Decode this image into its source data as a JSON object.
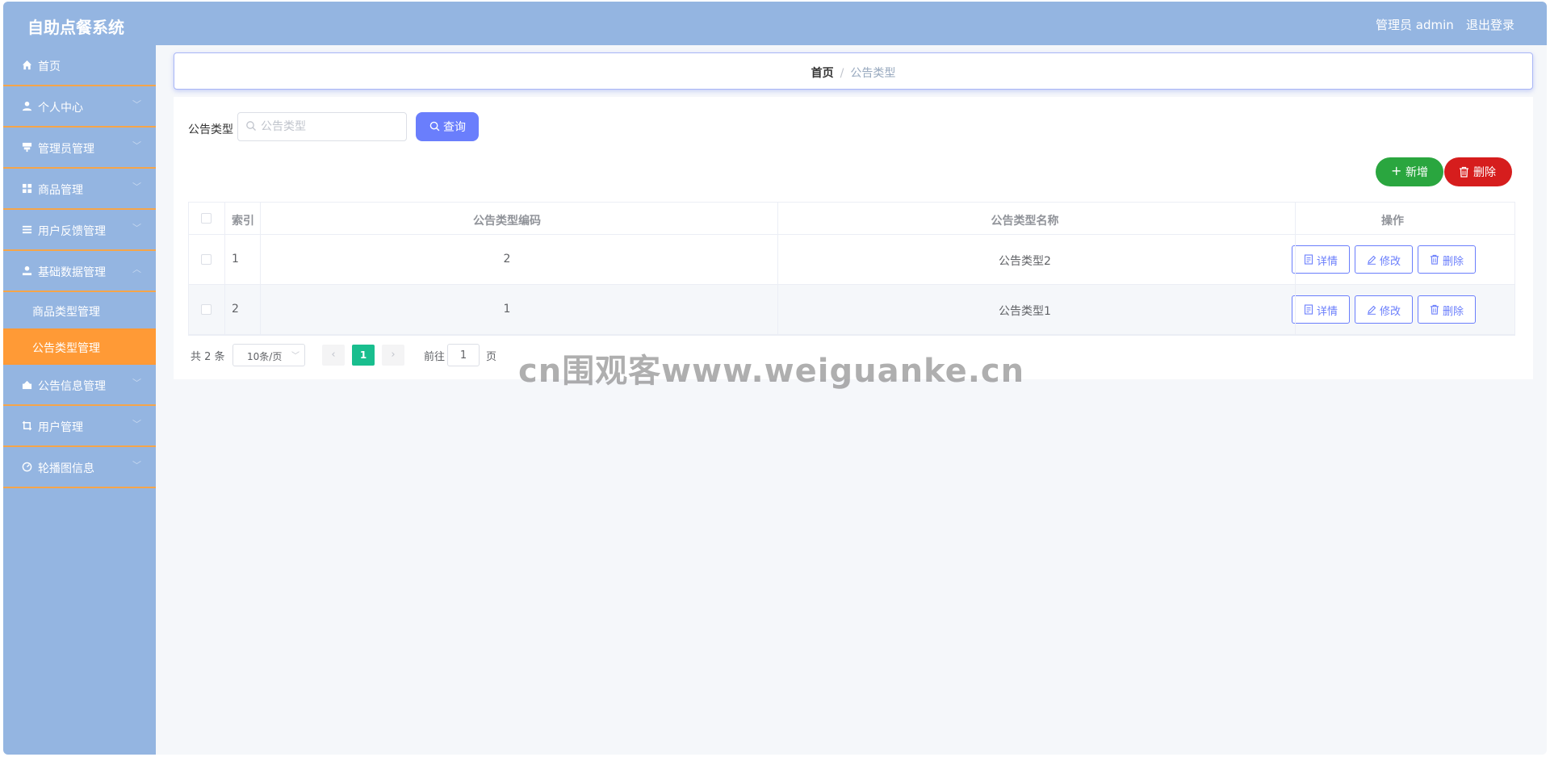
{
  "app": {
    "title": "自助点餐系统"
  },
  "header": {
    "user_text": "管理员 admin",
    "logout_label": "退出登录"
  },
  "sidebar": {
    "items": [
      {
        "label": "首页",
        "icon": "home-icon"
      },
      {
        "label": "个人中心",
        "icon": "user-icon"
      },
      {
        "label": "管理员管理",
        "icon": "admin-icon"
      },
      {
        "label": "商品管理",
        "icon": "grid-icon"
      },
      {
        "label": "用户反馈管理",
        "icon": "list-icon"
      },
      {
        "label": "基础数据管理",
        "icon": "person-icon"
      },
      {
        "label": "公告信息管理",
        "icon": "announce-icon"
      },
      {
        "label": "用户管理",
        "icon": "crop-icon"
      },
      {
        "label": "轮播图信息",
        "icon": "dashboard-icon"
      }
    ],
    "subitems": [
      {
        "label": "商品类型管理",
        "active": false
      },
      {
        "label": "公告类型管理",
        "active": true
      }
    ],
    "active_color": "#ff9a36"
  },
  "breadcrumb": {
    "home": "首页",
    "separator": "/",
    "current": "公告类型"
  },
  "filter": {
    "label": "公告类型",
    "placeholder": "公告类型",
    "value": "",
    "query_label": "查询"
  },
  "actions": {
    "add_label": "新增",
    "delete_label": "删除"
  },
  "table": {
    "headers": [
      "索引",
      "公告类型编码",
      "公告类型名称",
      "操作"
    ],
    "rows": [
      {
        "index": "1",
        "code": "2",
        "name": "公告类型2"
      },
      {
        "index": "2",
        "code": "1",
        "name": "公告类型1"
      }
    ],
    "row_actions": {
      "detail": "详情",
      "edit": "修改",
      "delete": "删除"
    }
  },
  "pagination": {
    "total_text": "共 2 条",
    "page_size": "10条/页",
    "current_page": "1",
    "goto_label": "前往",
    "goto_value": "1",
    "page_suffix": "页"
  },
  "watermark": "cn围观客www.weiguanke.cn",
  "colors": {
    "header_bg": "#94b5e1",
    "primary": "#6a7efc",
    "success": "#2aa63f",
    "danger": "#d61d1d",
    "pager_active": "#19be8e"
  }
}
